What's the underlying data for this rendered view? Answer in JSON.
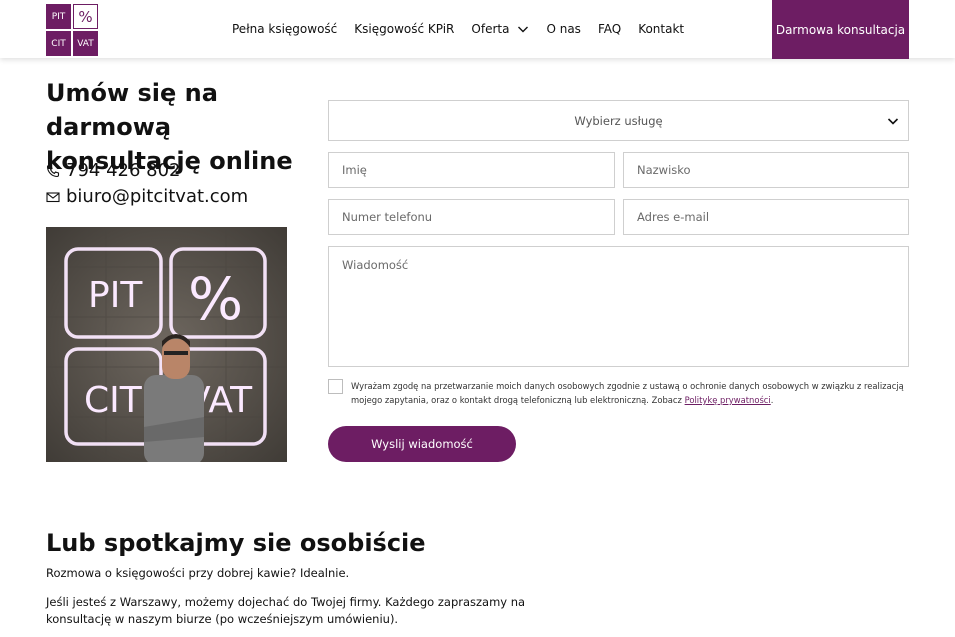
{
  "header": {
    "logo": {
      "tl": "PIT",
      "tr": "%",
      "bl": "CIT",
      "br": "VAT"
    },
    "nav": [
      {
        "label": "Pełna księgowość"
      },
      {
        "label": "Księgowość KPiR"
      },
      {
        "label": "Oferta",
        "has_dropdown": true
      },
      {
        "label": "O nas"
      },
      {
        "label": "FAQ"
      },
      {
        "label": "Kontakt"
      }
    ],
    "cta_label": "Darmowa konsultacja"
  },
  "intro": {
    "title": "Umów się na darmową konsultację online",
    "phone": "794 426 802",
    "email": "biuro@pitcitvat.com",
    "photo_sign": {
      "tl": "PIT",
      "tr": "%",
      "bl": "CIT",
      "br": "VAT"
    }
  },
  "form": {
    "service_select": "Wybierz usługę",
    "first_name_placeholder": "Imię",
    "last_name_placeholder": "Nazwisko",
    "phone_placeholder": "Numer telefonu",
    "email_placeholder": "Adres e-mail",
    "message_placeholder": "Wiadomość",
    "consent_text": "Wyrażam zgodę na przetwarzanie moich danych osobowych zgodnie z ustawą o ochronie danych osobowych w związku z realizacją mojego zapytania, oraz o kontakt drogą telefoniczną lub elektroniczną. Zobacz",
    "consent_link": "Politykę prywatności",
    "consent_end": ".",
    "consent_checked": false,
    "submit_label": "Wyslij wiadomość"
  },
  "meet": {
    "title": "Lub spotkajmy sie osobiście",
    "p1": "Rozmowa o księgowości przy dobrej kawie? Idealnie.",
    "p2": "Jeśli jesteś z Warszawy, możemy dojechać do Twojej firmy. Każdego zapraszamy na konsultację w naszym biurze (po wcześniejszym umówieniu)."
  },
  "colors": {
    "brand": "#6d1d63",
    "border": "#cfcfcf"
  },
  "icons": {
    "phone": "phone-icon",
    "email": "envelope-icon",
    "dropdown": "chevron-down-icon"
  }
}
